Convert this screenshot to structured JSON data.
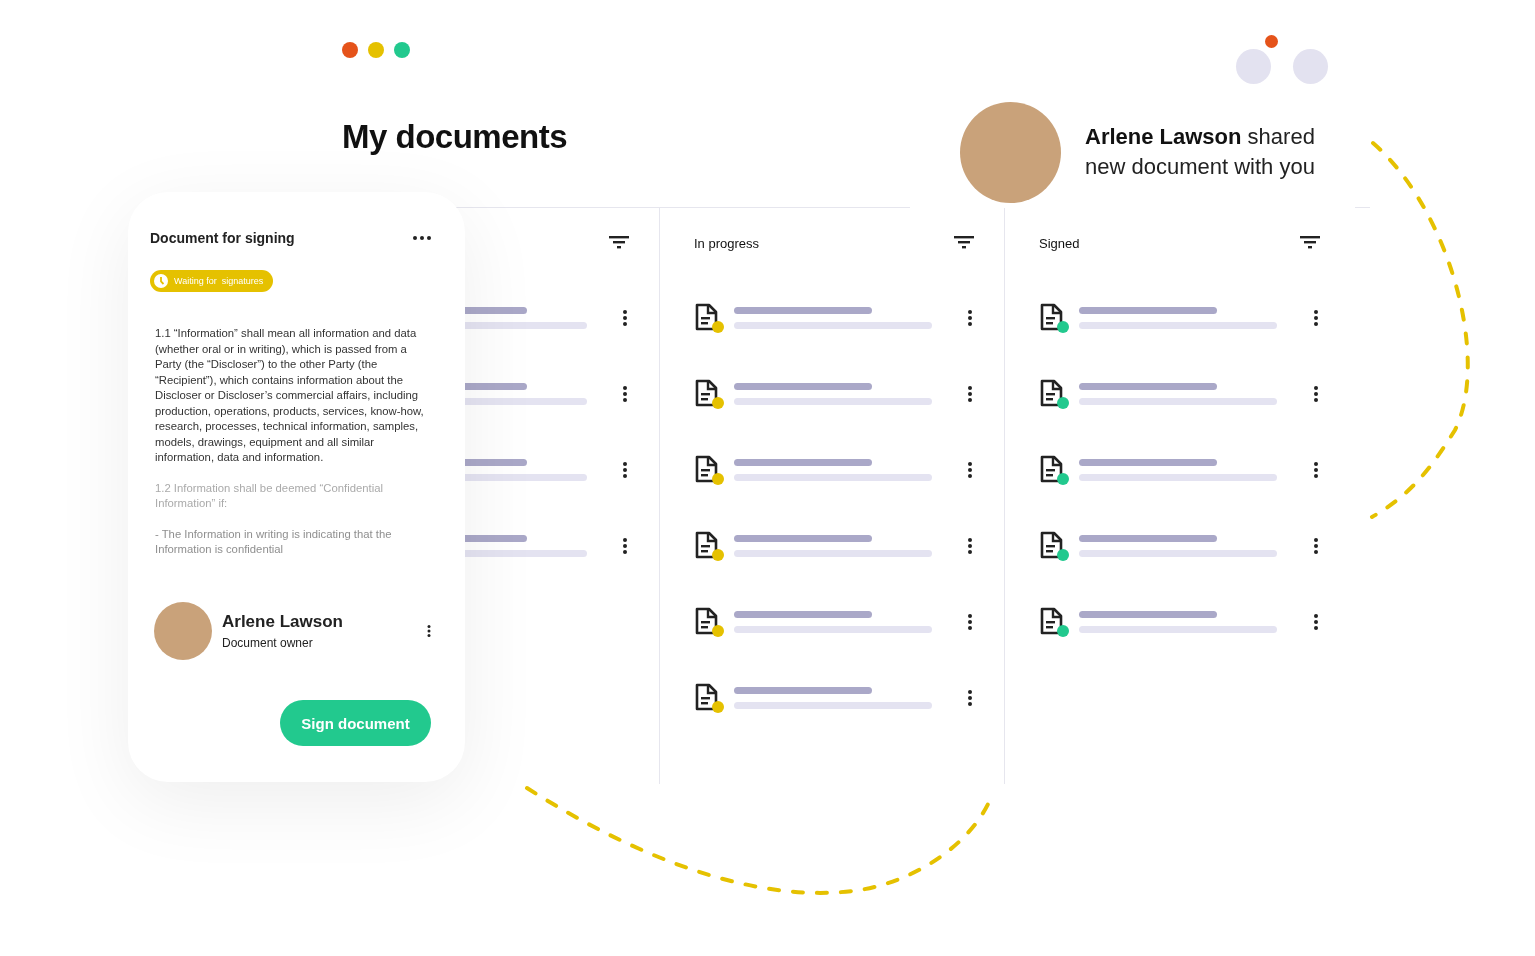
{
  "window_dots": [
    {
      "color": "#e5531a"
    },
    {
      "color": "#e5c100"
    },
    {
      "color": "#22c98e"
    }
  ],
  "title": "My documents",
  "notification": {
    "message": "**Arlene Lawson** shared new document with you"
  },
  "columns": [
    {
      "rows": [
        {
          "kind": "bars"
        },
        {
          "kind": "bars"
        },
        {
          "kind": "bars"
        },
        {
          "kind": "bars"
        }
      ]
    },
    {
      "title": "In progress",
      "color": "#e5c100",
      "rows": [
        {
          "kind": "document"
        },
        {
          "kind": "document"
        },
        {
          "kind": "document"
        },
        {
          "kind": "document"
        },
        {
          "kind": "document"
        },
        {
          "kind": "document"
        }
      ]
    },
    {
      "title": "Signed",
      "color": "#22c98e",
      "rows": [
        {
          "kind": "document"
        },
        {
          "kind": "document"
        },
        {
          "kind": "document"
        },
        {
          "kind": "document"
        },
        {
          "kind": "document"
        }
      ]
    }
  ],
  "card": {
    "title": "Document for signing",
    "badge": "Waiting for  signatures",
    "paragraphs": [
      "1.1 “Information” shall mean all information and data (whether oral or in writing), which is passed from a Party (the “Discloser”) to the other Party (the “Recipient”), which contains information about the Discloser or Discloser’s commercial affairs, including production, operations, products, services, know-how, research, processes, technical information, samples, models, drawings, equipment and all similar information, data and information.",
      "1.2 Information shall be deemed “Confidential Information” if:",
      "- The Information in writing is indicating that the Information is confidential"
    ],
    "owner": {
      "name": "Arlene Lawson",
      "role": "Document owner"
    },
    "button": "Sign document"
  }
}
